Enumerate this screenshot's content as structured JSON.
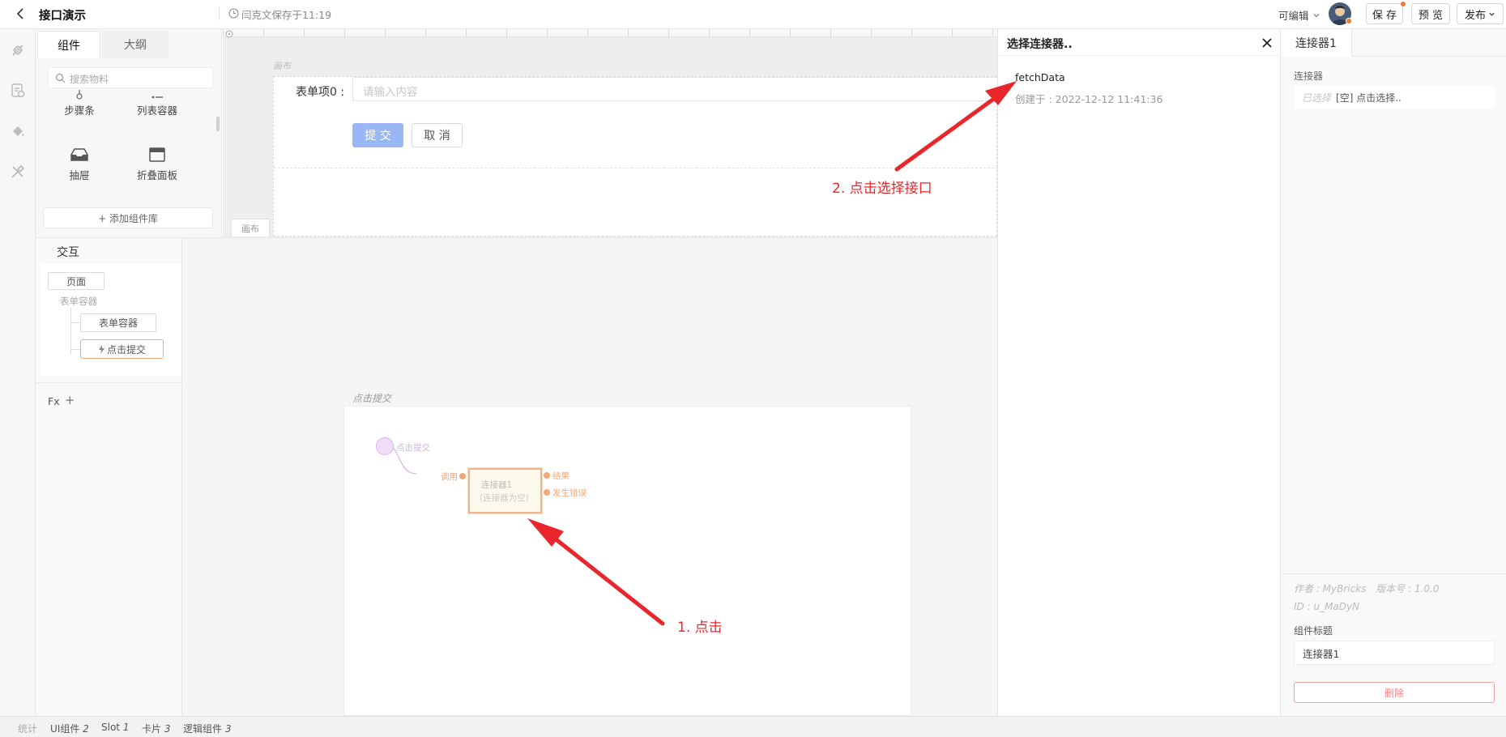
{
  "header": {
    "back_icon": "chevron-left-icon",
    "title": "接口演示",
    "save_status": "闫克文保存于11:19",
    "permission": "可编辑",
    "save_label": "保 存",
    "preview_label": "预 览",
    "publish_label": "发布"
  },
  "left_rail": {
    "icons": [
      "connector-icon",
      "data-icon",
      "paint-bucket-icon",
      "tools-icon"
    ]
  },
  "components_panel": {
    "tabs": [
      "组件",
      "大纲"
    ],
    "search_placeholder": "搜索物料",
    "items": [
      {
        "label": "步骤条",
        "icon": "steps-icon"
      },
      {
        "label": "列表容器",
        "icon": "list-icon"
      },
      {
        "label": "抽屉",
        "icon": "drawer-icon"
      },
      {
        "label": "折叠面板",
        "icon": "collapse-icon"
      }
    ],
    "add_library_label": "+ 添加组件库"
  },
  "canvas": {
    "top_label": "画布",
    "bottom_tab_label": "画布",
    "form": {
      "field_label": "表单项0 :",
      "field_placeholder": "请输入内容",
      "submit_label": "提 交",
      "cancel_label": "取 消"
    }
  },
  "interaction": {
    "title": "交互",
    "tree": {
      "page_label": "页面",
      "form_group_label": "表单容器",
      "form_container_label": "表单容器",
      "click_submit_label": "点击提交"
    },
    "fx_label": "Fx",
    "add_label": "+",
    "flow": {
      "title": "点击提交",
      "event_label": "点击提交",
      "invoke_label": "调用",
      "node_name": "连接器1",
      "node_sub": "(连接器为空)",
      "result_label": "结果",
      "error_label": "发生错误"
    }
  },
  "selector_panel": {
    "title": "选择连接器..",
    "item_name": "fetchData",
    "item_created": "创建于 : 2022-12-12 11:41:36"
  },
  "properties_panel": {
    "tab_label": "连接器1",
    "connector_label": "连接器",
    "selected_prefix": "已选择",
    "selected_value": "[空] 点击选择..",
    "author": "作者 : MyBricks",
    "version": "版本号 : 1.0.0",
    "id": "ID : u_MaDyN",
    "title_label": "组件标题",
    "title_value": "连接器1",
    "delete_label": "删除"
  },
  "status_bar": {
    "stats_label": "统计",
    "ui_label": "UI组件",
    "ui_count": "2",
    "slot_label": "Slot",
    "slot_count": "1",
    "card_label": "卡片",
    "card_count": "3",
    "logic_label": "逻辑组件",
    "logic_count": "3"
  },
  "annotations": {
    "step1": "1. 点击",
    "step2": "2. 点击选择接口"
  },
  "colors": {
    "accent_red": "#e8262b",
    "primary_blue": "#99b7f4",
    "node_orange": "#f0a77a",
    "node_fill": "#fdf9ec",
    "event_purple": "#d9b6ec"
  }
}
